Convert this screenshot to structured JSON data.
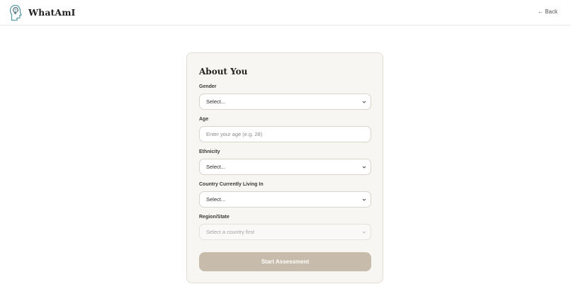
{
  "header": {
    "app_title": "WhatAmI",
    "logo_icon": "head-brain-icon",
    "back_label": "← Back"
  },
  "form": {
    "title": "About You",
    "fields": {
      "gender": {
        "label": "Gender",
        "value": "Select..."
      },
      "age": {
        "label": "Age",
        "placeholder": "Enter your age (e.g. 28)"
      },
      "ethnicity": {
        "label": "Ethnicity",
        "value": "Select..."
      },
      "country": {
        "label": "Country Currently Living In",
        "value": "Select..."
      },
      "region": {
        "label": "Region/State",
        "value": "Select a country first"
      }
    },
    "submit_label": "Start Assessment"
  },
  "colors": {
    "card_bg": "#f8f6f2",
    "button_bg": "#c7bbab",
    "logo_teal": "#5a9ba6",
    "logo_dark": "#2c4a5a"
  }
}
